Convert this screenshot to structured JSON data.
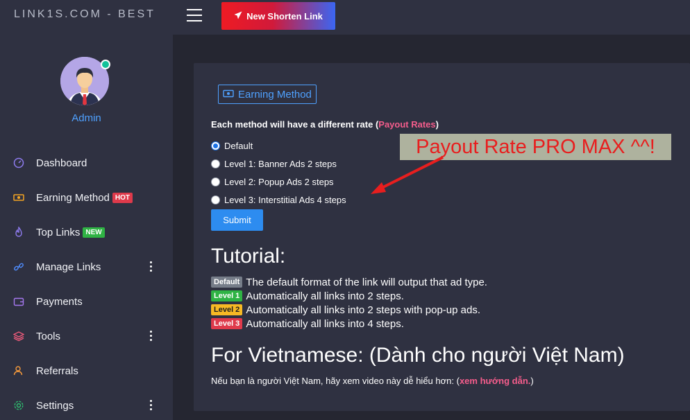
{
  "brand": "LINK1S.COM - BEST",
  "topbar": {
    "new_link_label": "New Shorten Link"
  },
  "user": {
    "name": "Admin"
  },
  "sidebar": {
    "items": [
      {
        "label": "Dashboard",
        "icon": "gauge-icon"
      },
      {
        "label": "Earning Method",
        "icon": "money-icon",
        "badge": "HOT"
      },
      {
        "label": "Top Links",
        "icon": "fire-icon",
        "badge": "NEW"
      },
      {
        "label": "Manage Links",
        "icon": "link-icon"
      },
      {
        "label": "Payments",
        "icon": "wallet-icon"
      },
      {
        "label": "Tools",
        "icon": "layers-icon"
      },
      {
        "label": "Referrals",
        "icon": "users-icon"
      },
      {
        "label": "Settings",
        "icon": "gear-icon"
      }
    ]
  },
  "main": {
    "tab_label": "Earning Method",
    "rate_prefix": "Each method will have a different rate (",
    "rate_link": "Payout Rates",
    "rate_suffix": ")",
    "options": [
      {
        "label": "Default",
        "checked": true
      },
      {
        "label": "Level 1: Banner Ads 2 steps",
        "checked": false
      },
      {
        "label": "Level 2: Popup Ads 2 steps",
        "checked": false
      },
      {
        "label": "Level 3: Interstitial Ads 4 steps",
        "checked": false
      }
    ],
    "submit_label": "Submit",
    "tutorial_title": "Tutorial:",
    "tutorial": [
      {
        "badge": "Default",
        "text": "The default format of the link will output that ad type."
      },
      {
        "badge": "Level 1",
        "text": "Automatically all links into 2 steps."
      },
      {
        "badge": "Level 2",
        "text": "Automatically all links into 2 steps with pop-up ads."
      },
      {
        "badge": "Level 3",
        "text": "Automatically all links into 4 steps."
      }
    ],
    "vn_title": "For Vietnamese: (Dành cho người Việt Nam)",
    "vn_text": "Nếu bạn là người Việt Nam, hãy xem video này dễ hiểu hơn: (",
    "vn_link": "xem hướng dẫn.",
    "vn_suffix": ")"
  },
  "annotation": "Payout Rate PRO MAX ^^!",
  "colors": {
    "accent_blue": "#4fa1ff",
    "pink": "#f55d8c",
    "hot": "#df3a4b",
    "new": "#2fb344",
    "level2": "#f7b924"
  }
}
